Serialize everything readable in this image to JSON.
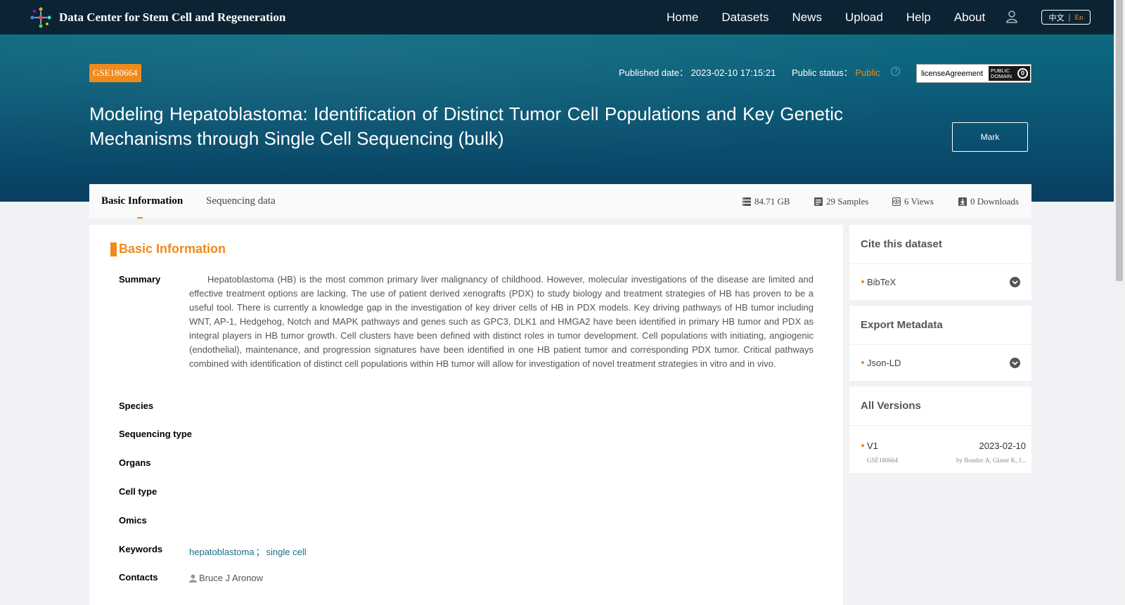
{
  "site": {
    "title": "Data Center for Stem Cell and Regeneration"
  },
  "nav": {
    "items": [
      "Home",
      "Datasets",
      "News",
      "Upload",
      "Help",
      "About"
    ],
    "lang_zh": "中文",
    "lang_sep": "|",
    "lang_en": "En"
  },
  "dataset": {
    "id": "GSE180664",
    "published_label": "Published date：",
    "published_value": "2023-02-10 17:15:21",
    "status_label": "Public status：",
    "status_value": "Public",
    "help_glyph": "?",
    "license_text": "licenseAgreement",
    "license_badge_line1": "PUBLIC",
    "license_badge_line2": "DOMAIN",
    "license_badge_symbol": "0",
    "title": "Modeling Hepatoblastoma: Identification of Distinct Tumor Cell Populations and Key Genetic Mechanisms through Single Cell Sequencing (bulk)",
    "mark_label": "Mark"
  },
  "tabs": {
    "basic": "Basic Information",
    "sequencing": "Sequencing data"
  },
  "stats": {
    "size": "84.71 GB",
    "samples": "29 Samples",
    "views": "6 Views",
    "downloads": "0 Downloads"
  },
  "basic": {
    "section_title": "Basic Information",
    "labels": {
      "summary": "Summary",
      "species": "Species",
      "sequencing_type": "Sequencing type",
      "organs": "Organs",
      "cell_type": "Cell type",
      "omics": "Omics",
      "keywords": "Keywords",
      "contacts": "Contacts"
    },
    "summary": "Hepatoblastoma (HB) is the most common primary liver malignancy of childhood. However, molecular investigations of the disease are limited and effective treatment options are lacking. The use of patient derived xenografts (PDX) to study biology and treatment strategies of HB has proven to be a useful tool. There is currently a knowledge gap in the investigation of key driver cells of HB in PDX models. Key driving pathways of HB tumor including WNT, AP-1, Hedgehog, Notch and MAPK pathways and genes such as GPC3, DLK1 and HMGA2 have been identified in primary HB tumor and PDX as integral players in HB tumor growth. Cell clusters have been defined with distinct roles in tumor development. Cell populations with initiating, angiogenic (endothelial), maintenance, and progression signatures have been identified in one HB patient tumor and corresponding PDX tumor. Critical pathways combined with identification of distinct cell populations within HB tumor will allow for investigation of novel treatment strategies in vitro and in vivo.",
    "keywords": [
      "hepatoblastoma",
      "single cell"
    ],
    "keyword_sep": "；",
    "contact": "Bruce J Aronow"
  },
  "sidebar": {
    "cite_title": "Cite this dataset",
    "cite_item": "BibTeX",
    "export_title": "Export Metadata",
    "export_item": "Json-LD",
    "versions_title": "All Versions",
    "version": {
      "label": "V1",
      "date": "2023-02-10",
      "id": "GSE180664",
      "authors": "by Bondoc A, Glaser K, J..."
    }
  },
  "colors": {
    "accent": "#f08a1c",
    "nav_bg": "#0c2333",
    "hero_top": "#0d6a80",
    "hero_bottom": "#0a3e61",
    "link": "#1a6d8a"
  }
}
